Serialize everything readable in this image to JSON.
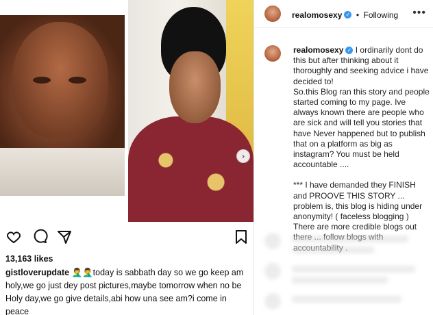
{
  "post": {
    "likes": "13,163 likes",
    "caption_user": "gistloverupdate",
    "caption_text": " 🤦‍♂️🤦‍♂️today is sabbath day so we go keep am holy,we go just dey post pictures,maybe tomorrow when no be Holy day,we go give details,abi how una see am?i come in peace"
  },
  "profile": {
    "username": "realomosexy",
    "follow_status": "Following"
  },
  "comment": {
    "username": "realomosexy",
    "paragraph_1": "I ordinarily dont do this but after thinking about it thoroughly and seeking advice i have decided to!",
    "paragraph_2": "So.this Blog ran this story and people started coming to my page. Ive always known there are people who are sick and will tell you stories that have Never happened but to publish that on a platform as big as instagram? You must be held accountable ....",
    "paragraph_3": "*** I have demanded they FINISH and PROOVE THIS STORY ... problem is, this blog is hiding under anonymity! ( faceless blogging ) There are more credible blogs out there ... follow blogs with accountability ."
  },
  "icons": [
    "heart-icon",
    "comment-icon",
    "share-icon",
    "bookmark-icon",
    "verified-icon",
    "more-options-icon",
    "carousel-next-icon"
  ],
  "colors": {
    "verified": "#3897f0",
    "text": "#111111"
  }
}
